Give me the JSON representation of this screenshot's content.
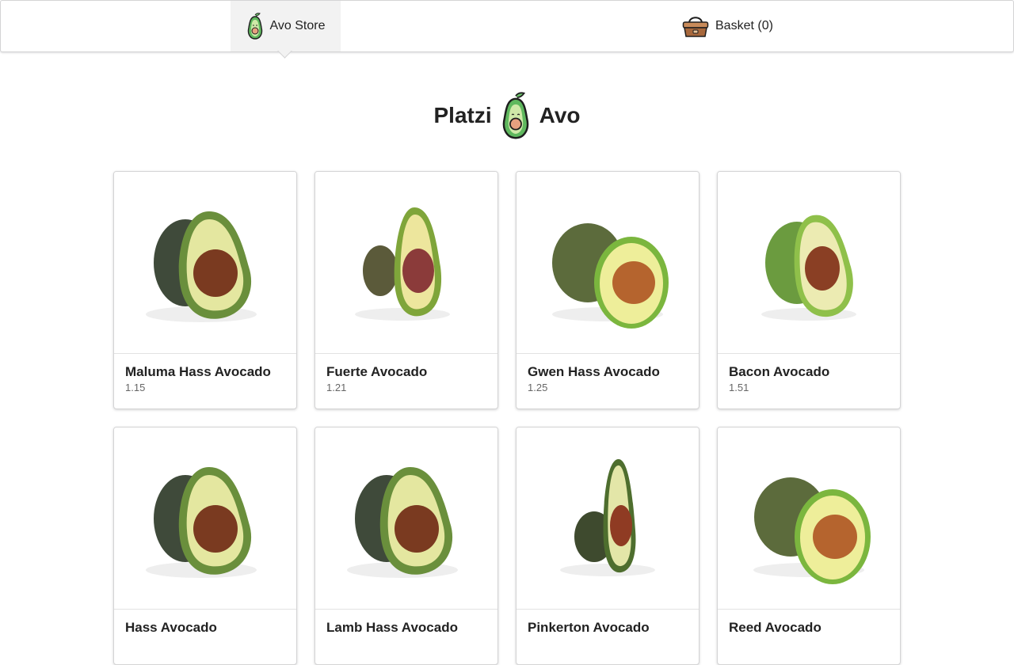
{
  "nav": {
    "store_label": "Avo Store",
    "basket_label": "Basket (0)"
  },
  "hero": {
    "left_text": "Platzi",
    "right_text": "Avo"
  },
  "products": [
    {
      "name": "Maluma Hass Avocado",
      "price": "1.15",
      "image": "avocado-image"
    },
    {
      "name": "Fuerte Avocado",
      "price": "1.21",
      "image": "avocado-image"
    },
    {
      "name": "Gwen Hass Avocado",
      "price": "1.25",
      "image": "avocado-image"
    },
    {
      "name": "Bacon Avocado",
      "price": "1.51",
      "image": "avocado-image"
    },
    {
      "name": "Hass Avocado",
      "price": "",
      "image": "avocado-image"
    },
    {
      "name": "Lamb Hass Avocado",
      "price": "",
      "image": "avocado-image"
    },
    {
      "name": "Pinkerton Avocado",
      "price": "",
      "image": "avocado-image"
    },
    {
      "name": "Reed Avocado",
      "price": "",
      "image": "avocado-image"
    }
  ],
  "icons": {
    "logo": "avocado-logo-icon",
    "basket": "basket-icon"
  },
  "colors": {
    "avocado_green": "#6fbf6b",
    "avocado_flesh": "#dde68b",
    "pit": "#7a3a20"
  }
}
